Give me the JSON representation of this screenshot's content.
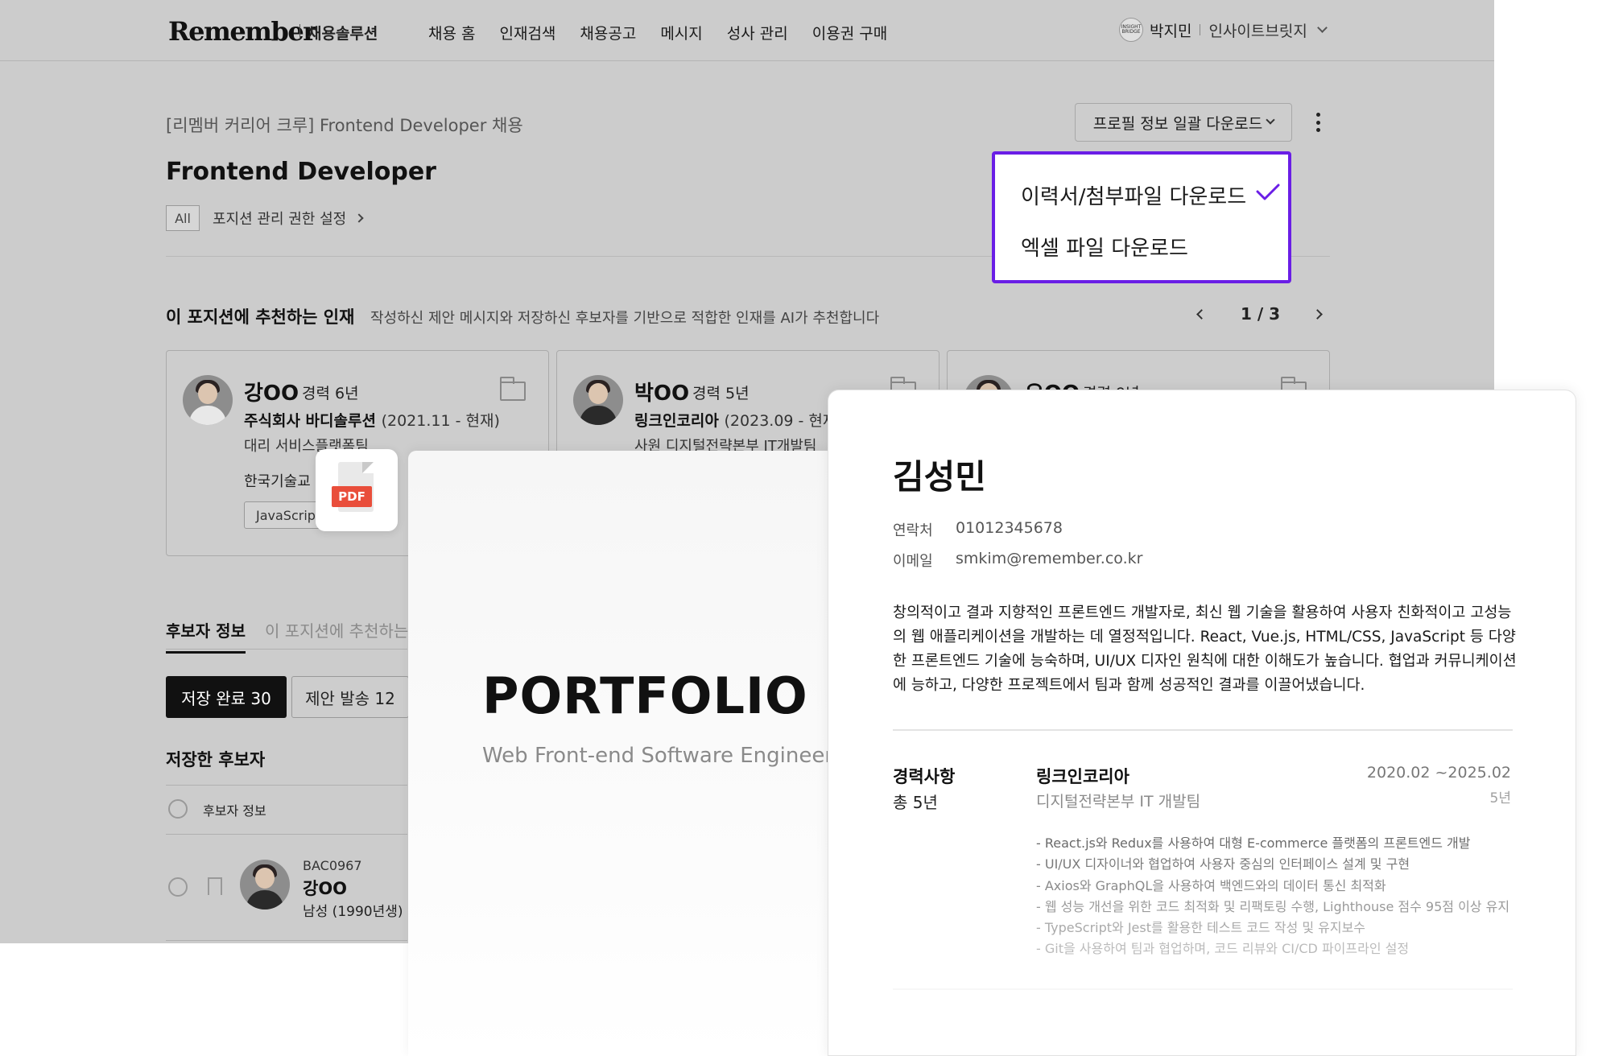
{
  "header": {
    "logo": "Remember",
    "logo_sub": "채용솔루션",
    "nav": [
      "채용 홈",
      "인재검색",
      "채용공고",
      "메시지",
      "성사 관리",
      "이용권 구매"
    ],
    "user_logo_text": "INSIGHT BRIDGE",
    "user_name": "박지민",
    "user_company": "인사이트브릿지"
  },
  "job": {
    "subtitle": "[리멤버 커리어 크루] Frontend Developer 채용",
    "title": "Frontend Developer",
    "badge": "All",
    "permission_link": "포지션 관리 권한 설정"
  },
  "toolbar": {
    "download_button": "프로필 정보 일괄 다운로드",
    "dropdown_items": [
      "이력서/첨부파일 다운로드",
      "엑셀 파일 다운로드"
    ],
    "selected_item": "이력서/첨부파일 다운로드",
    "accent_color": "#6a1ee6"
  },
  "recommend": {
    "title": "이 포지션에 추천하는 인재",
    "description": "작성하신 제안 메시지와 저장하신 후보자를 기반으로 적합한 인재를 AI가 추천합니다",
    "page": "1 / 3",
    "cards": [
      {
        "name": "강OO",
        "experience": "경력 6년",
        "company": "주식회사 바디솔루션",
        "period": "(2021.11 - 현재)",
        "role": "대리   서비스플랫폼팀",
        "education": "한국기술교",
        "skill": "JavaScrip"
      },
      {
        "name": "박OO",
        "experience": "경력 5년",
        "company": "링크인코리아",
        "period": "(2023.09 - 현재)",
        "role": "사원   디지털전략본부 IT개발팀"
      },
      {
        "name": "오OO",
        "experience": "경력 9년"
      }
    ]
  },
  "tabs": {
    "active": "후보자 정보",
    "inactive": "이 포지션에 추천하는"
  },
  "filters": {
    "saved": "저장 완료 30",
    "sent": "제안 발송 12"
  },
  "saved_list": {
    "title": "저장한 후보자",
    "header_label": "후보자 정보",
    "rows": [
      {
        "code": "BAC0967",
        "name": "강OO",
        "meta": "남성 (1990년생)"
      }
    ]
  },
  "pdf_icon_label": "PDF",
  "portfolio": {
    "title": "PORTFOLIO",
    "subtitle": "Web Front-end Software Engineer"
  },
  "resume": {
    "name": "김성민",
    "contact_label": "연락처",
    "contact_value": "01012345678",
    "email_label": "이메일",
    "email_value": "smkim@remember.co.kr",
    "intro": "창의적이고 결과 지향적인 프론트엔드 개발자로, 최신 웹 기술을 활용하여 사용자 친화적이고 고성능의 웹 애플리케이션을 개발하는 데 열정적입니다. React, Vue.js, HTML/CSS, JavaScript 등 다양한 프론트엔드 기술에 능숙하며, UI/UX 디자인 원칙에 대한 이해도가 높습니다. 협업과 커뮤니케이션에 능하고, 다양한 프로젝트에서 팀과 함께 성공적인 결과를 이끌어냈습니다.",
    "career_title": "경력사항",
    "career_total": "총 5년",
    "company": "링크인코리아",
    "department": "디지털전략본부 IT 개발팀",
    "period": "2020.02 ~2025.02",
    "years": "5년",
    "duties": [
      "- React.js와 Redux를 사용하여 대형 E-commerce 플랫폼의 프론트엔드 개발",
      "- UI/UX 디자이너와 협업하여 사용자 중심의 인터페이스 설계 및 구현",
      "- Axios와 GraphQL을 사용하여 백엔드와의 데이터 통신 최적화",
      "- 웹 성능 개선을 위한 코드 최적화 및 리팩토링 수행, Lighthouse 점수 95점 이상 유지",
      "- TypeScript와 Jest를 활용한 테스트 코드 작성 및 유지보수",
      "- Git을 사용하여 팀과 협업하며, 코드 리뷰와 CI/CD 파이프라인 설정"
    ]
  }
}
